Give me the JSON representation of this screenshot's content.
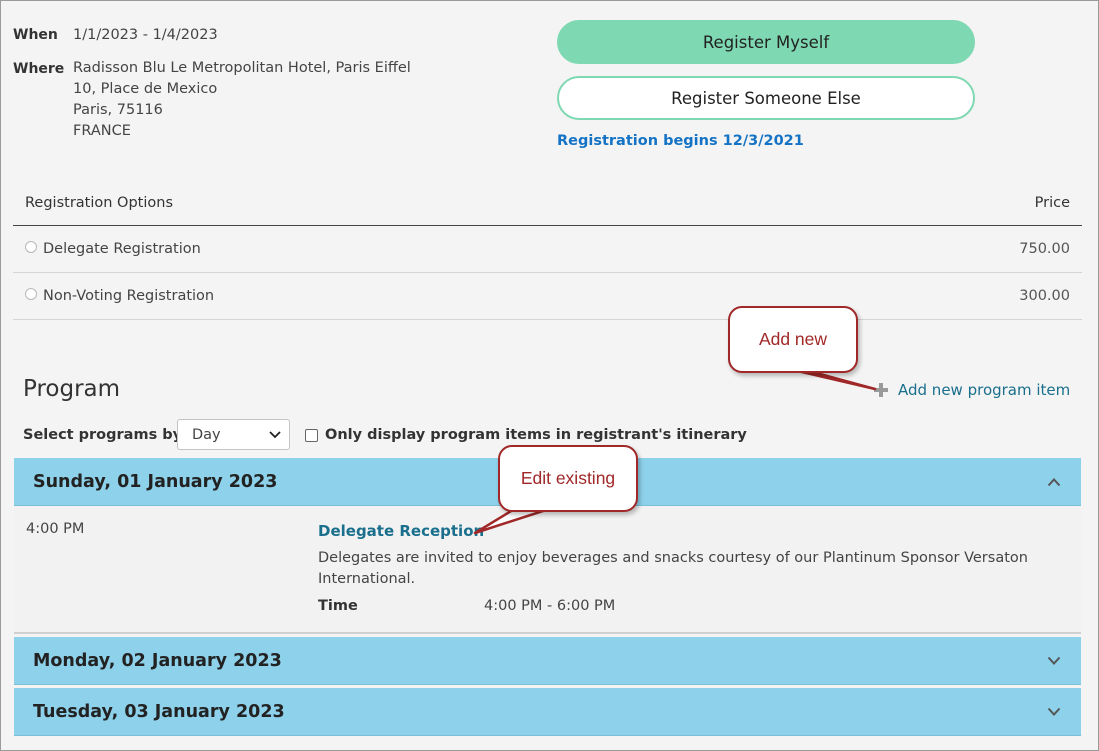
{
  "event": {
    "when_label": "When",
    "when_value": "1/1/2023 - 1/4/2023",
    "where_label": "Where",
    "where_lines": [
      "Radisson Blu Le Metropolitan Hotel, Paris Eiffel",
      "10, Place de Mexico",
      "Paris, 75116",
      "FRANCE"
    ]
  },
  "actions": {
    "register_myself": "Register Myself",
    "register_someone_else": "Register Someone Else",
    "registration_begins": "Registration begins 12/3/2021"
  },
  "registration_options": {
    "header_label": "Registration Options",
    "header_price": "Price",
    "options": [
      {
        "label": "Delegate Registration",
        "price": "750.00"
      },
      {
        "label": "Non-Voting Registration",
        "price": "300.00"
      }
    ]
  },
  "program": {
    "title": "Program",
    "add_new_label": "Add new program item",
    "select_label": "Select programs by",
    "select_value": "Day",
    "itinerary_label": "Only display program items in registrant's itinerary",
    "days": [
      {
        "label": "Sunday, 01 January 2023",
        "expanded": true,
        "items": [
          {
            "time": "4:00 PM",
            "title": "Delegate Reception",
            "description": "Delegates are invited to enjoy beverages and snacks courtesy of our Plantinum Sponsor Versaton International.",
            "time_label": "Time",
            "time_range": "4:00 PM - 6:00 PM"
          }
        ]
      },
      {
        "label": "Monday, 02 January 2023",
        "expanded": false
      },
      {
        "label": "Tuesday, 03 January 2023",
        "expanded": false
      }
    ]
  },
  "callouts": {
    "add_new": "Add new",
    "edit_existing": "Edit existing"
  },
  "colors": {
    "primary_button": "#7ed8b2",
    "day_header": "#8ed1ea",
    "link": "#1a6f8c",
    "registration_begins": "#1473c4",
    "callout_border": "#a02828"
  }
}
